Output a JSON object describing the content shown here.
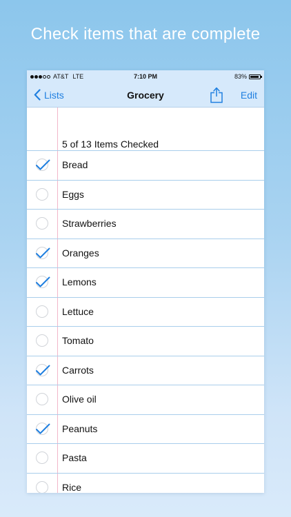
{
  "headline": "Check items that are complete",
  "status_bar": {
    "carrier": "AT&T",
    "network": "LTE",
    "time": "7:10 PM",
    "battery": "83%",
    "signal_bars": 3,
    "signal_total": 5
  },
  "nav": {
    "back_label": "Lists",
    "title": "Grocery",
    "share_icon": "share-icon",
    "edit_label": "Edit"
  },
  "summary": "5 of 13 Items Checked",
  "colors": {
    "accent": "#1f7fe0",
    "rule": "#a8cdeb",
    "margin": "#f2b6c9",
    "bar": "#d6e9fb"
  },
  "items": [
    {
      "label": "Bread",
      "checked": true
    },
    {
      "label": "Eggs",
      "checked": false
    },
    {
      "label": "Strawberries",
      "checked": false
    },
    {
      "label": "Oranges",
      "checked": true
    },
    {
      "label": "Lemons",
      "checked": true
    },
    {
      "label": "Lettuce",
      "checked": false
    },
    {
      "label": "Tomato",
      "checked": false
    },
    {
      "label": "Carrots",
      "checked": true
    },
    {
      "label": "Olive oil",
      "checked": false
    },
    {
      "label": "Peanuts",
      "checked": true
    },
    {
      "label": "Pasta",
      "checked": false
    },
    {
      "label": "Rice",
      "checked": false
    }
  ]
}
